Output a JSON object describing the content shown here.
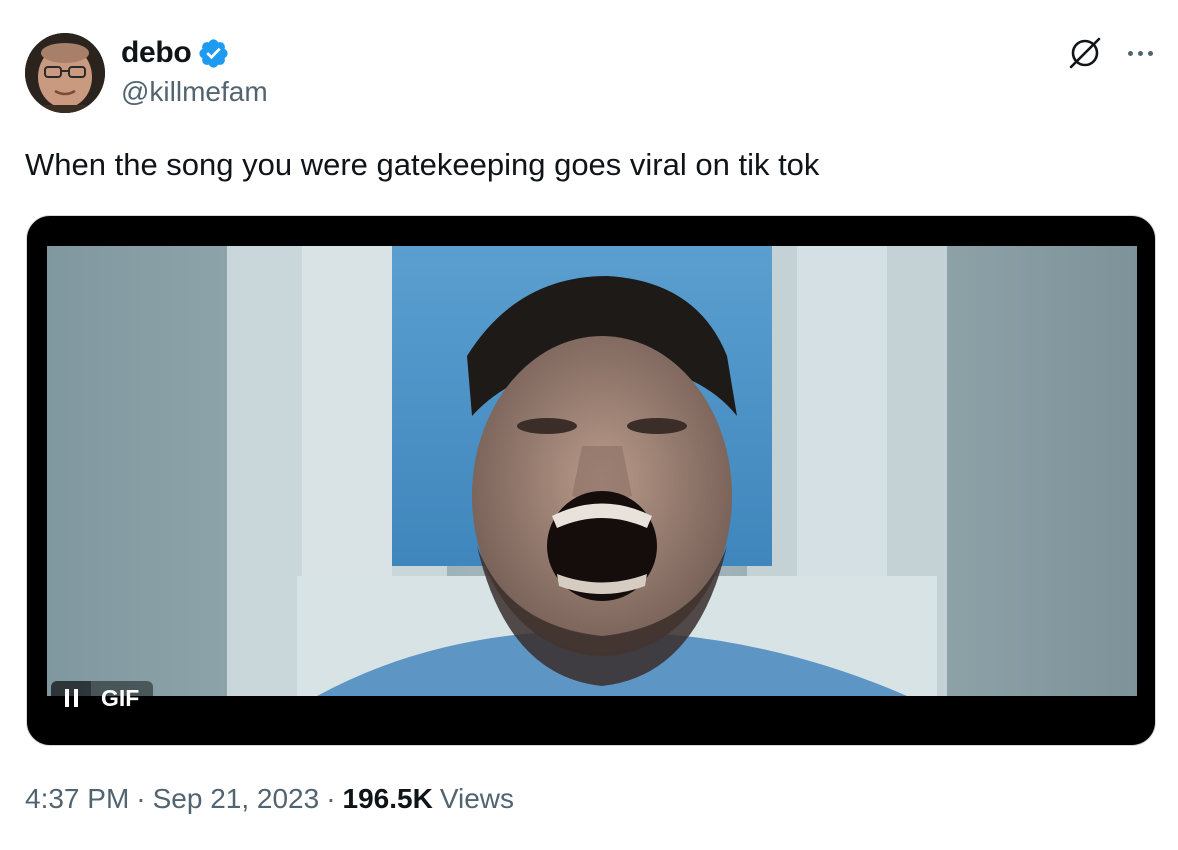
{
  "author": {
    "display_name": "debo",
    "handle": "@killmefam",
    "verified": true,
    "verified_color": "#1d9bf0"
  },
  "tweet": {
    "text": "When the song you were gatekeeping goes viral on tik tok"
  },
  "media": {
    "type_label": "GIF",
    "playback_state": "playing"
  },
  "meta": {
    "time": "4:37 PM",
    "separator": "·",
    "date": "Sep 21, 2023",
    "views_count": "196.5K",
    "views_label": "Views"
  },
  "icons": {
    "grok": "grok-icon",
    "more": "more-options-icon",
    "pause": "pause-icon",
    "verified": "verified-badge-icon"
  },
  "colors": {
    "text_primary": "#0f1419",
    "text_secondary": "#536471",
    "border": "#cfd9de",
    "accent": "#1d9bf0"
  }
}
